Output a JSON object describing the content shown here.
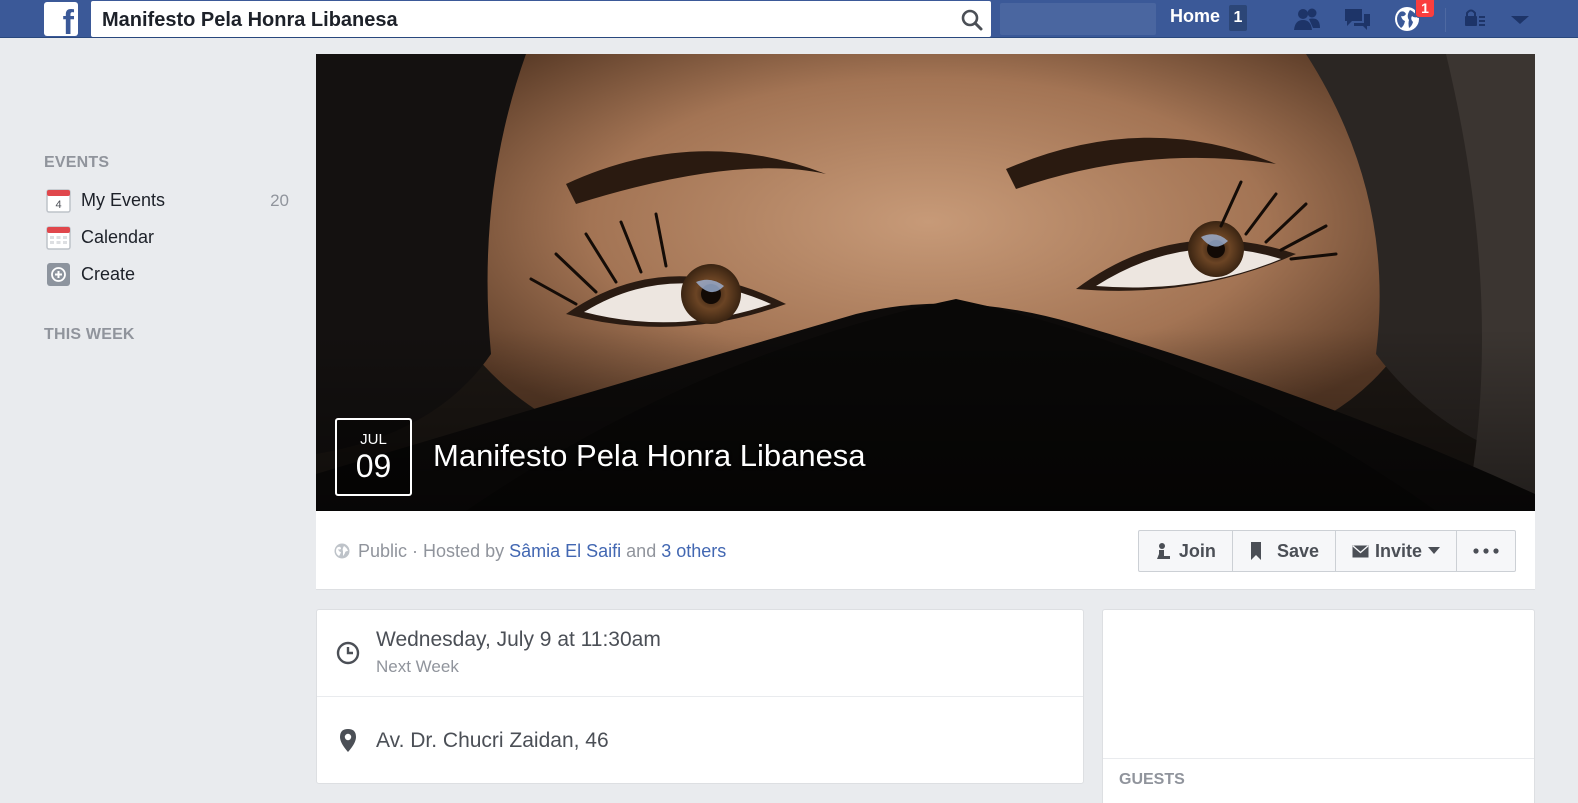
{
  "topbar": {
    "search_value": "Manifesto Pela Honra Libanesa",
    "home_label": "Home",
    "home_count": "1",
    "notifications_count": "1",
    "brand_color": "#3b5998"
  },
  "sidebar": {
    "events_header": "EVENTS",
    "items": [
      {
        "label": "My Events",
        "count": "20",
        "icon": "calendar-day-icon",
        "icon_text": "4"
      },
      {
        "label": "Calendar",
        "icon": "calendar-icon"
      },
      {
        "label": "Create",
        "icon": "plus-icon"
      }
    ],
    "this_week_header": "THIS WEEK"
  },
  "event": {
    "month": "JUL",
    "day": "09",
    "title": "Manifesto Pela Honra Libanesa",
    "privacy": "Public",
    "hosted_prefix": "· Hosted by",
    "host_name": "Sâmia El Saifi",
    "and_text": "and",
    "others_link": "3 others",
    "actions": {
      "join": "Join",
      "save": "Save",
      "invite": "Invite"
    },
    "when": "Wednesday, July 9 at 11:30am",
    "when_sub": "Next Week",
    "where": "Av. Dr. Chucri Zaidan, 46"
  },
  "right_panel": {
    "guests_header": "GUESTS"
  }
}
